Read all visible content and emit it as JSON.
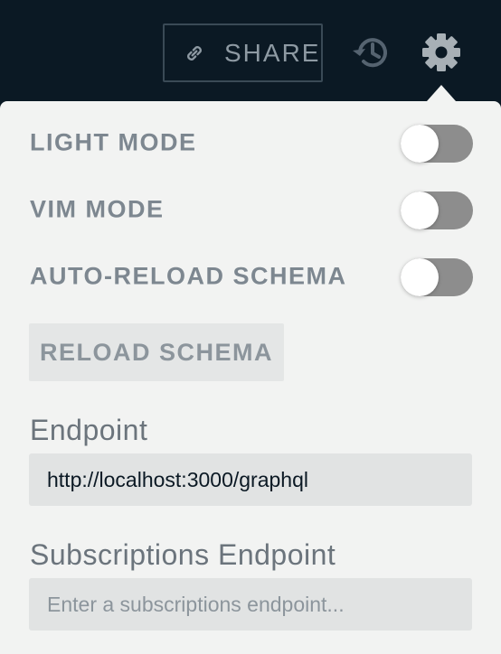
{
  "topbar": {
    "share_label": "SHARE",
    "icons": {
      "share": "link-icon",
      "history": "history-icon",
      "settings": "gear-icon"
    }
  },
  "settings": {
    "toggles": [
      {
        "label": "LIGHT MODE",
        "on": false
      },
      {
        "label": "VIM MODE",
        "on": false
      },
      {
        "label": "AUTO-RELOAD SCHEMA",
        "on": false
      }
    ],
    "reload_label": "RELOAD SCHEMA",
    "endpoint": {
      "label": "Endpoint",
      "value": "http://localhost:3000/graphql"
    },
    "subscriptions": {
      "label": "Subscriptions Endpoint",
      "value": "",
      "placeholder": "Enter a subscriptions endpoint..."
    }
  },
  "colors": {
    "topbar_bg": "#0b1924",
    "panel_bg": "#f2f3f2",
    "toggle_off": "#8d8d8d"
  }
}
